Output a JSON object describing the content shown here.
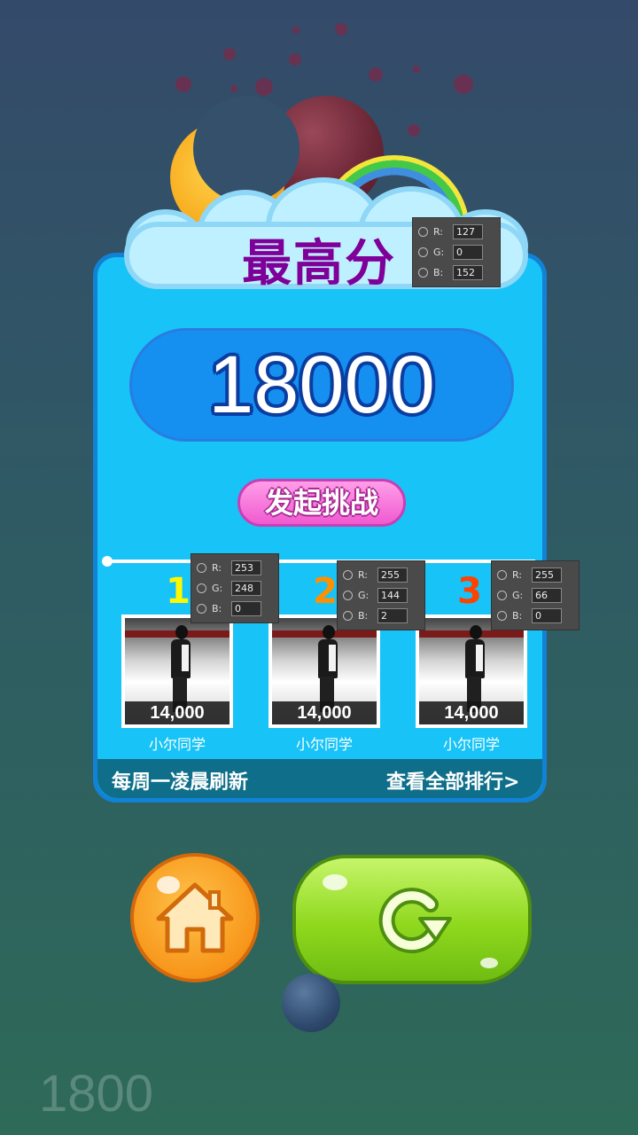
{
  "title": "最高分",
  "best_score": "18000",
  "challenge_button": "发起挑战",
  "leaderboard": [
    {
      "rank": "1",
      "score": "14,000",
      "name": "小尔同学",
      "rank_color": "#fdf800"
    },
    {
      "rank": "2",
      "score": "14,000",
      "name": "小尔同学",
      "rank_color": "#ff9002"
    },
    {
      "rank": "3",
      "score": "14,000",
      "name": "小尔同学",
      "rank_color": "#ff4200"
    }
  ],
  "footer": {
    "refresh_note": "每周一凌晨刷新",
    "view_all": "查看全部排行>"
  },
  "color_pickers": [
    {
      "r": "127",
      "g": "0",
      "b": "152"
    },
    {
      "r": "253",
      "g": "248",
      "b": "0"
    },
    {
      "r": "255",
      "g": "144",
      "b": "2"
    },
    {
      "r": "255",
      "g": "66",
      "b": "0"
    }
  ],
  "picker_labels": {
    "r": "R:",
    "g": "G:",
    "b": "B:"
  },
  "bottom_number": "1800",
  "icons": [
    "home-icon",
    "replay-icon"
  ],
  "colors": {
    "title": "#7f0098",
    "panel": "#17c3f7",
    "score_box": "#1590f0",
    "challenge": "#f05ad0",
    "home_button": "#f7961a",
    "replay_button": "#8fd81e"
  }
}
